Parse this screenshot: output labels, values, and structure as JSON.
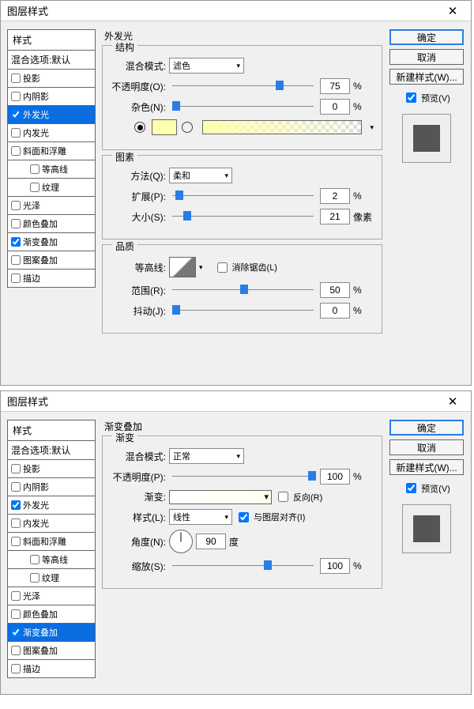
{
  "dialog1": {
    "title": "图层样式",
    "styleHeader": "样式",
    "blendDefault": "混合选项:默认",
    "items": [
      "投影",
      "内阴影",
      "外发光",
      "内发光",
      "斜面和浮雕",
      "等高线",
      "纹理",
      "光泽",
      "颜色叠加",
      "渐变叠加",
      "图案叠加",
      "描边"
    ],
    "checked": {
      "2": true,
      "9": true
    },
    "selected": 2,
    "sectionTitle": "外发光",
    "struct": {
      "title": "结构",
      "blendModeLabel": "混合模式:",
      "blendMode": "滤色",
      "opacityLabel": "不透明度(O):",
      "opacity": "75",
      "noiseLabel": "杂色(N):",
      "noise": "0",
      "solidColor": "#ffffb0",
      "pct": "%"
    },
    "element": {
      "title": "图素",
      "methodLabel": "方法(Q):",
      "method": "柔和",
      "spreadLabel": "扩展(P):",
      "spread": "2",
      "sizeLabel": "大小(S):",
      "size": "21",
      "pct": "%",
      "px": "像素"
    },
    "quality": {
      "title": "品质",
      "contourLabel": "等高线:",
      "antiAlias": "消除锯齿(L)",
      "rangeLabel": "范围(R):",
      "range": "50",
      "jitterLabel": "抖动(J):",
      "jitter": "0",
      "pct": "%"
    },
    "buttons": {
      "ok": "确定",
      "cancel": "取消",
      "newStyle": "新建样式(W)...",
      "preview": "预览(V)"
    }
  },
  "dialog2": {
    "title": "图层样式",
    "styleHeader": "样式",
    "blendDefault": "混合选项:默认",
    "items": [
      "投影",
      "内阴影",
      "外发光",
      "内发光",
      "斜面和浮雕",
      "等高线",
      "纹理",
      "光泽",
      "颜色叠加",
      "渐变叠加",
      "图案叠加",
      "描边"
    ],
    "checked": {
      "2": true,
      "9": true
    },
    "selected": 9,
    "sectionTitle": "渐变叠加",
    "grad": {
      "title": "渐变",
      "blendModeLabel": "混合模式:",
      "blendMode": "正常",
      "opacityLabel": "不透明度(P):",
      "opacity": "100",
      "gradLabel": "渐变:",
      "reverse": "反向(R)",
      "styleLabel": "样式(L):",
      "style": "线性",
      "alignLayer": "与图层对齐(I)",
      "angleLabel": "角度(N):",
      "angle": "90",
      "deg": "度",
      "scaleLabel": "缩放(S):",
      "scale": "100",
      "pct": "%"
    },
    "buttons": {
      "ok": "确定",
      "cancel": "取消",
      "newStyle": "新建样式(W)...",
      "preview": "预览(V)"
    }
  }
}
